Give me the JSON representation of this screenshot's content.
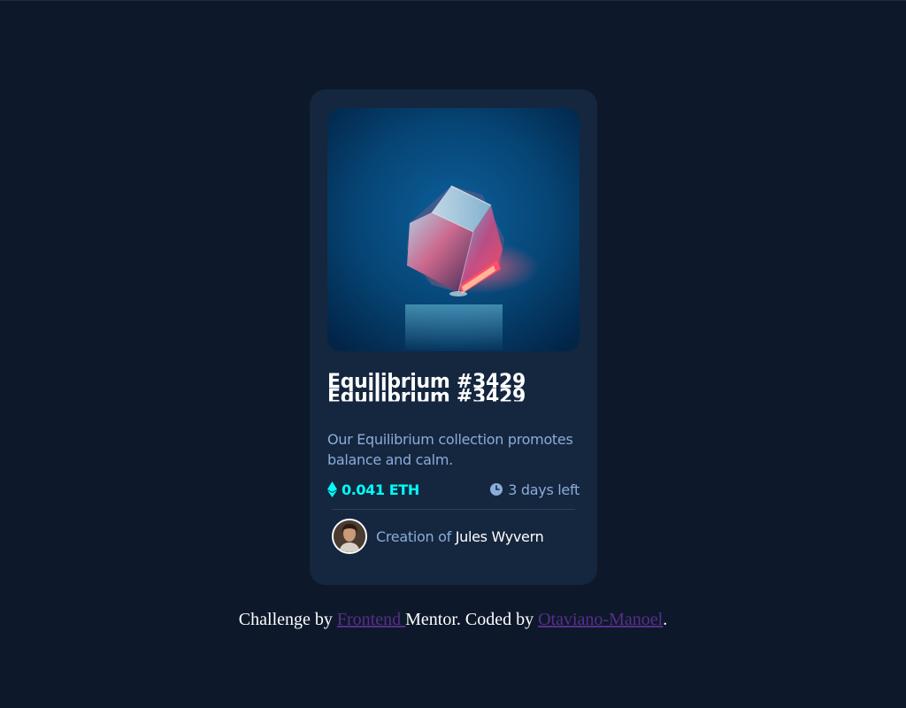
{
  "card": {
    "title": "Equilibrium #3429",
    "description": "Our Equilibrium collection promotes balance and calm.",
    "price": "0.041 ETH",
    "time_left": "3 days left",
    "creator_prefix": "Creation of",
    "creator_name": "Jules Wyvern",
    "icons": [
      "ethereum-icon",
      "clock-icon"
    ]
  },
  "footer": {
    "prefix": "Challenge by",
    "link1": "Frontend ",
    "middle": "Mentor. Coded by",
    "link2": "Otaviano-Manoel",
    "suffix": "."
  },
  "colors": {
    "page_background": "#0d192b",
    "card_background": "#15263f",
    "cyan": "#00fff8",
    "soft_blue": "#8bacd9",
    "white": "#ffffff",
    "link": "#5a2d8a"
  }
}
